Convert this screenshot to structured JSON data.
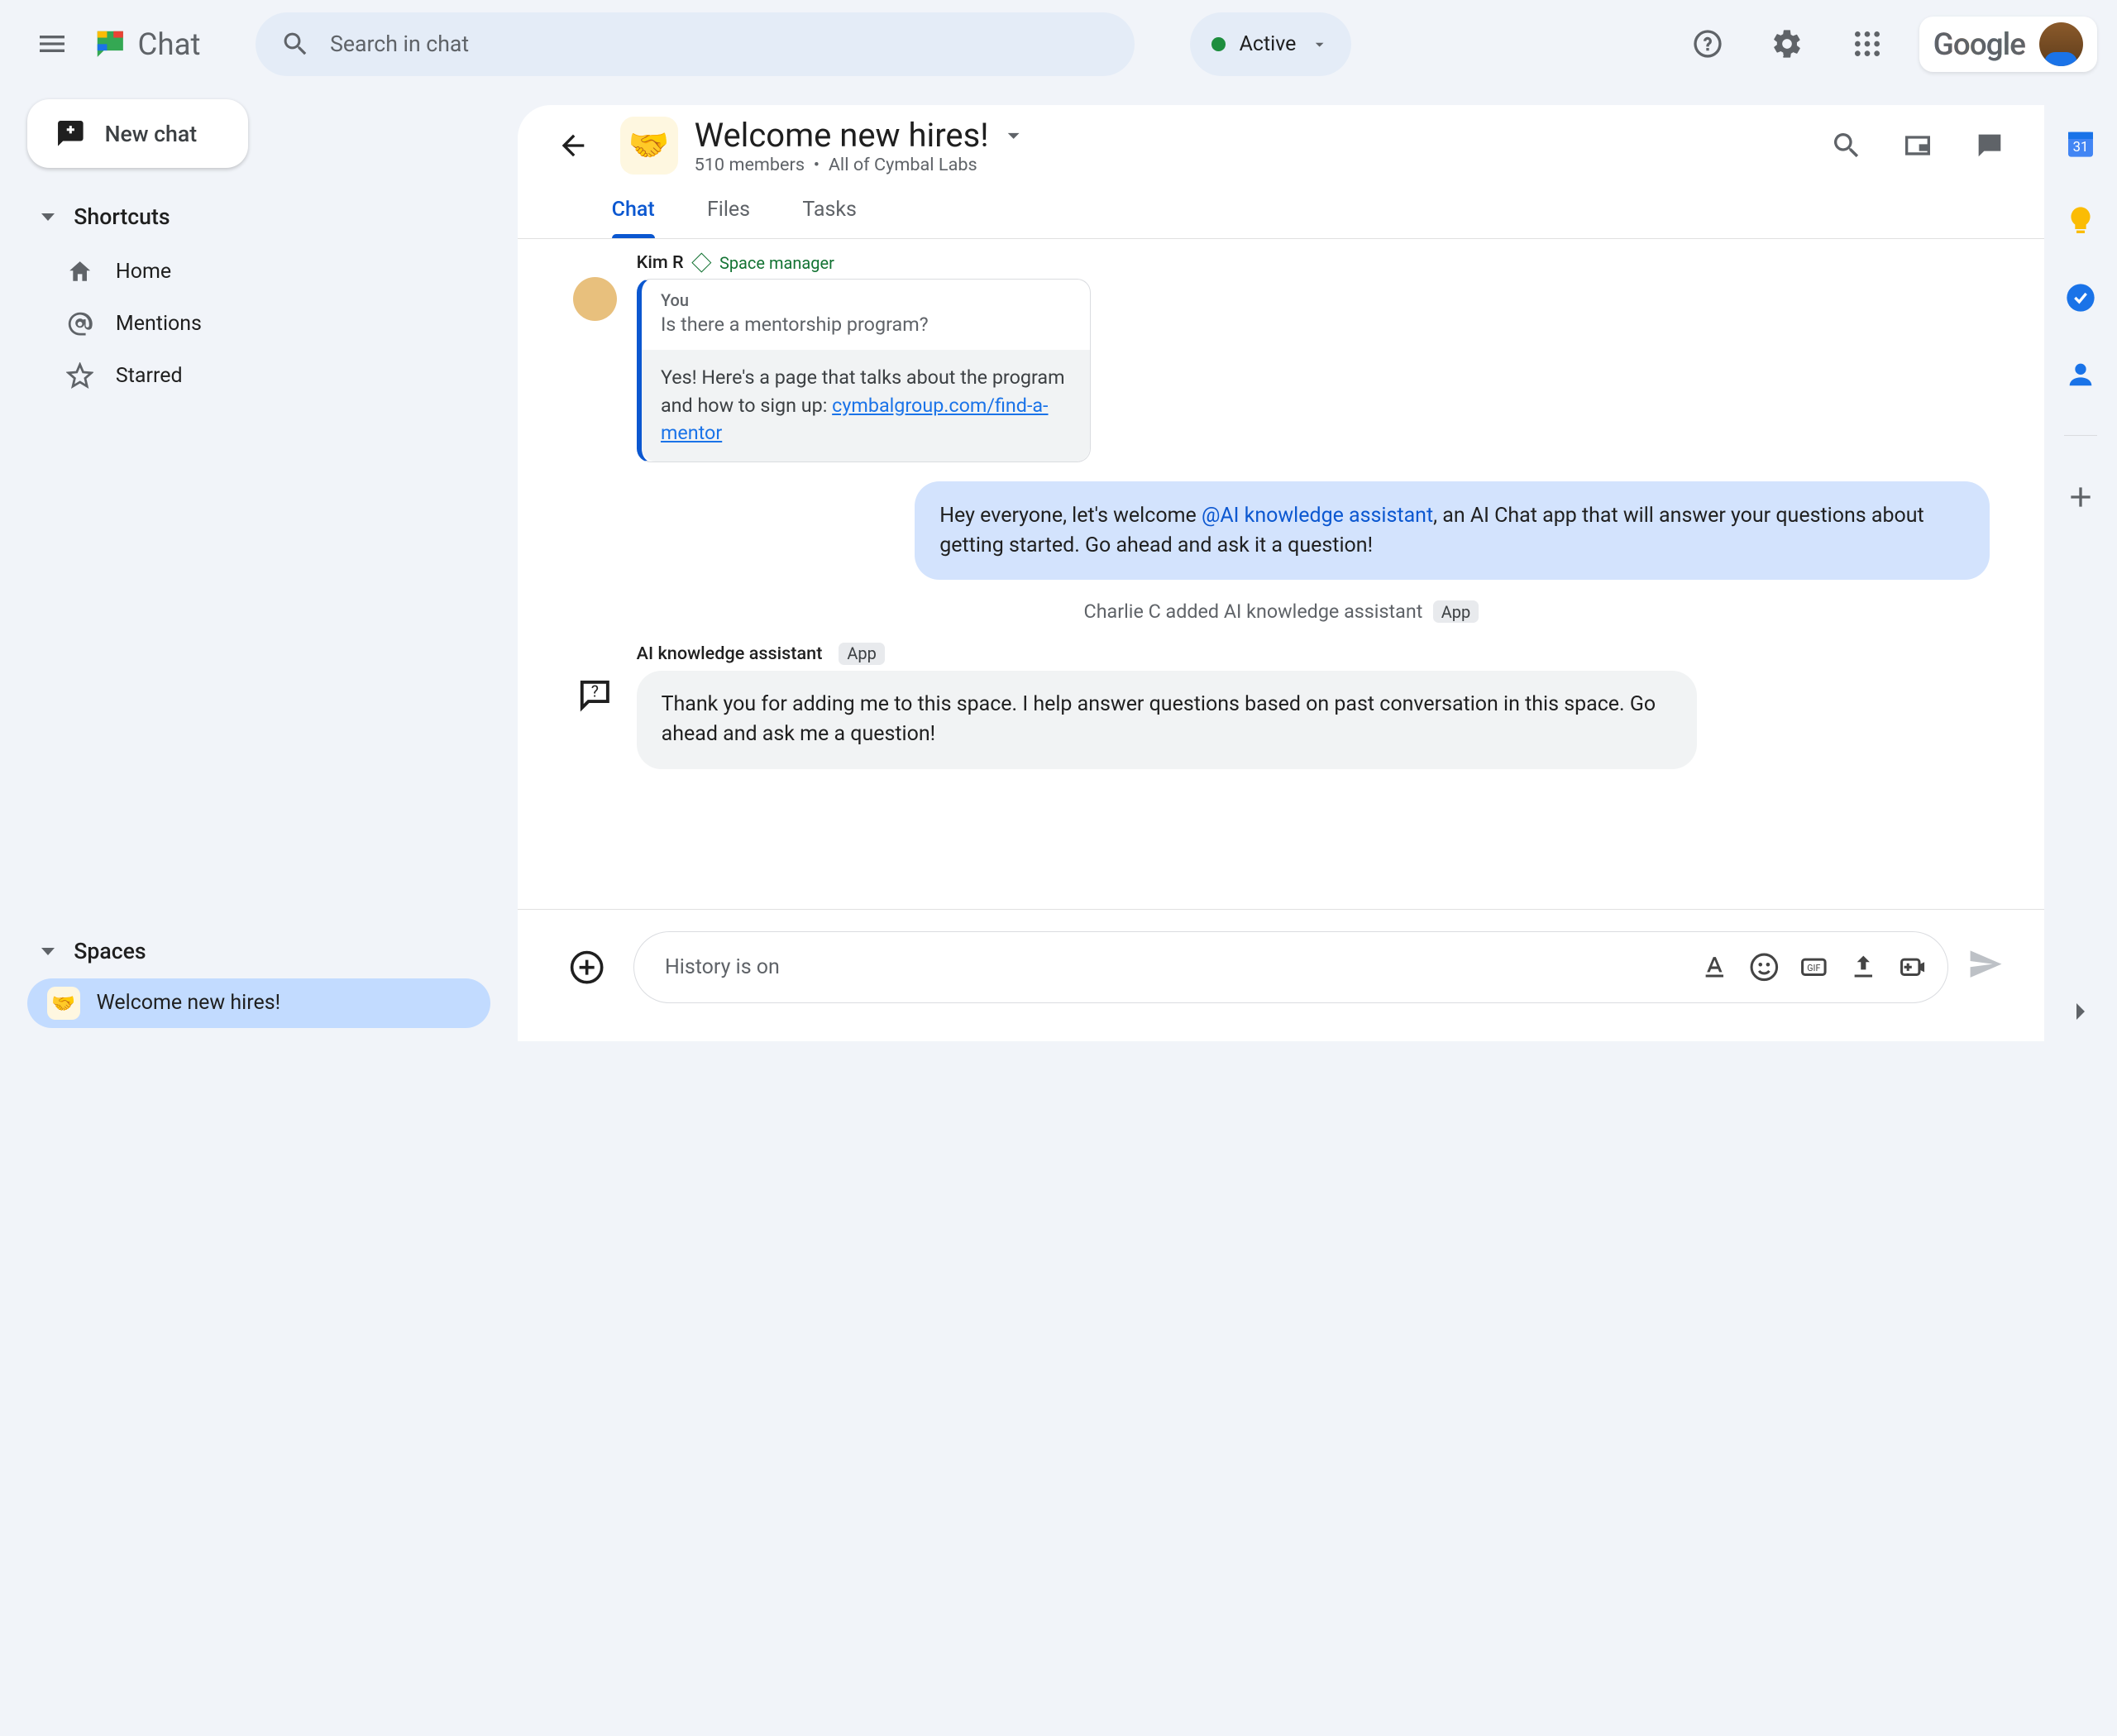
{
  "app_name": "Chat",
  "search_placeholder": "Search in chat",
  "status": {
    "label": "Active"
  },
  "brand": "Google",
  "new_chat_label": "New chat",
  "shortcuts_header": "Shortcuts",
  "shortcuts": [
    {
      "label": "Home"
    },
    {
      "label": "Mentions"
    },
    {
      "label": "Starred"
    }
  ],
  "spaces_header": "Spaces",
  "spaces": [
    {
      "emoji": "🤝",
      "label": "Welcome new hires!",
      "active": true
    }
  ],
  "conversation": {
    "emoji": "🤝",
    "title": "Welcome new hires!",
    "members": "510 members",
    "scope": "All of Cymbal Labs",
    "tabs": [
      "Chat",
      "Files",
      "Tasks"
    ],
    "active_tab": 0
  },
  "messages": {
    "kim": {
      "name": "Kim R",
      "role": "Space manager",
      "quote_you": "You",
      "quote_text": "Is there a mentorship program?",
      "reply_pre": "Yes! Here's a page that talks about the program and how to sign up: ",
      "reply_link": "cymbalgroup.com/find-a-mentor"
    },
    "mine": {
      "pre": "Hey everyone, let's welcome ",
      "mention": "@AI knowledge assistant",
      "post": ", an AI Chat app that will answer your questions about getting started.  Go ahead and ask it a question!"
    },
    "system": {
      "text": "Charlie C added AI knowledge assistant",
      "badge": "App"
    },
    "ai": {
      "name": "AI knowledge assistant",
      "badge": "App",
      "body": "Thank you for adding me to this space. I help answer questions based on past conversation in this space. Go ahead and ask me a question!"
    }
  },
  "composer_placeholder": "History is on"
}
